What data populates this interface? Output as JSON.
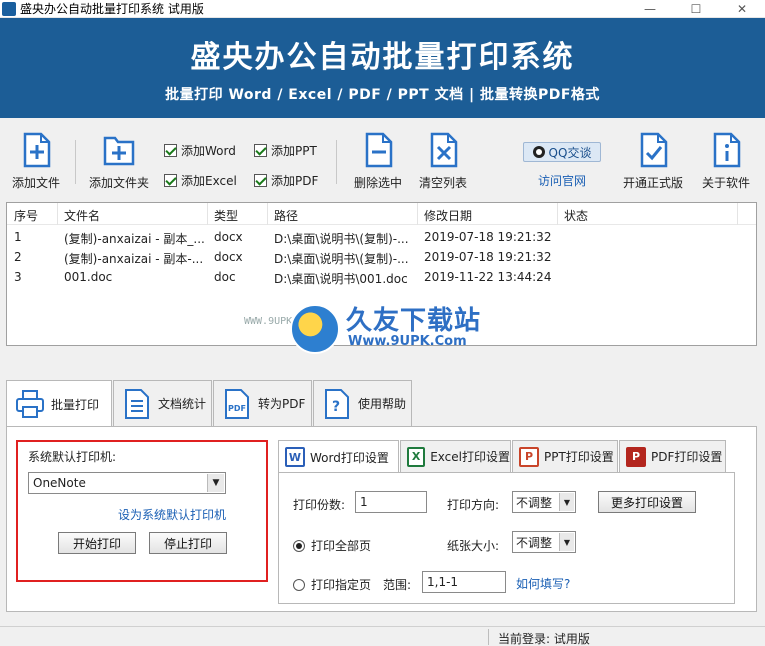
{
  "window": {
    "title": "盛央办公自动批量打印系统 试用版",
    "controls": [
      "—",
      "☐",
      "✕"
    ]
  },
  "banner": {
    "title": "盛央办公自动批量打印系统",
    "subtitle": "批量打印 Word / Excel / PDF / PPT 文档  |  批量转换PDF格式"
  },
  "toolbar": {
    "add_file": "添加文件",
    "add_folder": "添加文件夹",
    "chk_word": "添加Word",
    "chk_excel": "添加Excel",
    "chk_ppt": "添加PPT",
    "chk_pdf": "添加PDF",
    "delete_selected": "删除选中",
    "clear_list": "清空列表",
    "qq": "QQ交谈",
    "visit_site": "访问官网",
    "activate": "开通正式版",
    "about": "关于软件"
  },
  "table": {
    "headers": [
      "序号",
      "文件名",
      "类型",
      "路径",
      "修改日期",
      "状态"
    ],
    "rows": [
      {
        "no": "1",
        "name": "(复制)-anxaizai - 副本_...",
        "type": "docx",
        "path": "D:\\桌面\\说明书\\(复制)-...",
        "date": "2019-07-18 19:21:32",
        "status": ""
      },
      {
        "no": "2",
        "name": "(复制)-anxaizai - 副本-...",
        "type": "docx",
        "path": "D:\\桌面\\说明书\\(复制)-...",
        "date": "2019-07-18 19:21:32",
        "status": ""
      },
      {
        "no": "3",
        "name": "001.doc",
        "type": "doc",
        "path": "D:\\桌面\\说明书\\001.doc",
        "date": "2019-11-22 13:44:24",
        "status": ""
      }
    ]
  },
  "watermark": {
    "cn": "久友下载站",
    "en": "Www.9UPK.Com",
    "small": "WWW.9UPK.COM"
  },
  "main_tabs": [
    "批量打印",
    "文档统计",
    "转为PDF",
    "使用帮助"
  ],
  "printer": {
    "label": "系统默认打印机:",
    "selected": "OneNote",
    "set_default": "设为系统默认打印机",
    "start": "开始打印",
    "stop": "停止打印"
  },
  "sub_tabs": [
    "Word打印设置",
    "Excel打印设置",
    "PPT打印设置",
    "PDF打印设置"
  ],
  "settings": {
    "copies_label": "打印份数:",
    "copies_value": "1",
    "orientation_label": "打印方向:",
    "orientation_value": "不调整",
    "more_settings": "更多打印设置",
    "print_all": "打印全部页",
    "paper_label": "纸张大小:",
    "paper_value": "不调整",
    "print_range": "打印指定页",
    "range_label": "范围:",
    "range_value": "1,1-1",
    "how_to": "如何填写?"
  },
  "status": {
    "login": "当前登录: 试用版"
  },
  "colors": {
    "banner": "#1c5d96",
    "accent": "#2a72c7",
    "highlight_box": "#e02020",
    "link": "#1a5fb4"
  }
}
